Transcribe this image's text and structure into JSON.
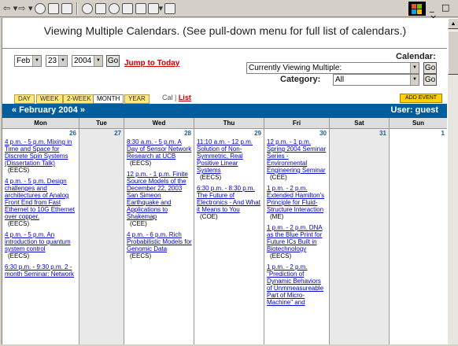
{
  "browser": {
    "toolbar_icons": [
      "back-icon",
      "forward-icon",
      "stop-icon",
      "refresh-icon",
      "home-icon",
      "search-icon",
      "favorites-icon",
      "history-icon",
      "mail-icon",
      "print-icon",
      "edit-icon",
      "discuss-icon"
    ]
  },
  "page": {
    "heading": "Viewing Multiple Calendars. (See pull-down menu for full list of calendars.)"
  },
  "date_controls": {
    "month": "Feb",
    "day": "23",
    "year": "2004",
    "go_label": "Go",
    "jump_label": "Jump to Today"
  },
  "calendar_select": {
    "label": "Calendar:",
    "value": "Currently Viewing Multiple:",
    "go_label": "Go"
  },
  "category_select": {
    "label": "Category:",
    "value": "All",
    "go_label": "Go"
  },
  "tabs": [
    {
      "label": "DAY"
    },
    {
      "label": "WEEK"
    },
    {
      "label": "2-WEEK"
    },
    {
      "label": "MONTH"
    },
    {
      "label": "YEAR"
    }
  ],
  "cal_links": {
    "cal": "Cal",
    "sep": "|",
    "list": "List"
  },
  "add_event": "ADD EVENT",
  "month_bar": {
    "title": "« February 2004 »",
    "user": "User: guest"
  },
  "colors": {
    "accent": "#005e9e",
    "tab": "#ffe87c",
    "add_event": "#ffd100"
  },
  "days": [
    {
      "name": "Mon",
      "num": "26",
      "events": [
        {
          "title": "4 p.m. - 5 p.m. Mixing in Time and Space for Discrete Spin Systems (Dissertation Talk)",
          "dept": "(EECS)"
        },
        {
          "title": "4 p.m. - 5 p.m. Design challenges and architectures of Analog Front End from Fast Ethernet to 10G Ethernet over copper.",
          "dept": "(EECS)"
        },
        {
          "title": "4 p.m. - 5 p.m. An introduction to quantum system control",
          "dept": "(EECS)"
        },
        {
          "title": "6:30 p.m. - 9:30 p.m. 2 - month Seminar: Network",
          "dept": ""
        }
      ]
    },
    {
      "name": "Tue",
      "num": "27",
      "events": []
    },
    {
      "name": "Wed",
      "num": "28",
      "events": [
        {
          "title": "8:30 a.m. - 5 p.m. A Day of Sensor Network Research at UCB",
          "dept": "(EECS)"
        },
        {
          "title": "12 p.m. - 1 p.m. Finite Source Models of the December 22, 2003 San Simeon Earthquake and Applications to Shakemap",
          "dept": "(CEE)"
        },
        {
          "title": "4 p.m. - 6 p.m. Rich Probabilistic Models for Genomic Data",
          "dept": "(EECS)"
        }
      ]
    },
    {
      "name": "Thu",
      "num": "29",
      "events": [
        {
          "title": "11:10 a.m. - 12 p.m. Solution of Non-Symmetric, Real Positive Linear Systems",
          "dept": "(EECS)"
        },
        {
          "title": "6:30 p.m. - 8:30 p.m. The Future of Electronics - And What it Means to You",
          "dept": "(COE)"
        }
      ]
    },
    {
      "name": "Fri",
      "num": "30",
      "events": [
        {
          "title": "12 p.m. - 1 p.m. Spring 2004 Seminar Series - Environmental Engineering Seminar",
          "dept": "(CEE)"
        },
        {
          "title": "1 p.m. - 2 p.m. Extended Hamilton's Principle for Fluid-Structure Interaction",
          "dept": "(ME)"
        },
        {
          "title": "1 p.m. - 2 p.m. DNA as the Blue Print for Future ICs Built in Biotechnology",
          "dept": "(EECS)"
        },
        {
          "title": "1 p.m. - 2 p.m. \"Prediction of Dynamic Behaviors of Unmmeasureable Part of Micro-Machine\" and",
          "dept": ""
        }
      ]
    },
    {
      "name": "Sat",
      "num": "31",
      "events": []
    },
    {
      "name": "Sun",
      "num": "1",
      "events": []
    }
  ]
}
